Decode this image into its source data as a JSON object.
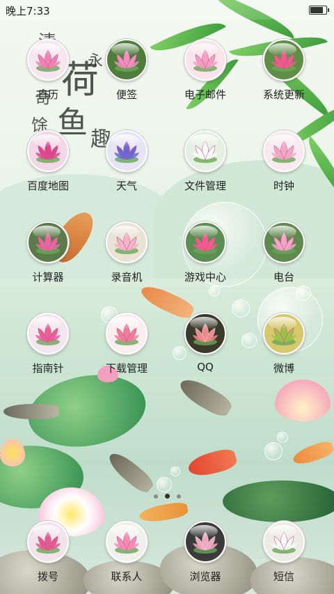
{
  "status_bar": {
    "time": "晚上7:33",
    "battery_level": 0.9
  },
  "icons": {
    "lotus": "lotus-flower-icon"
  },
  "apps": [
    {
      "id": "calendar",
      "label": "日历",
      "bg": "#f6e6ef",
      "flower": "#f07fb3"
    },
    {
      "id": "notes",
      "label": "便签",
      "bg": "#4f7d3c",
      "flower": "#f28dc0"
    },
    {
      "id": "email",
      "label": "电子邮件",
      "bg": "#fbe3ec",
      "flower": "#f59dc5"
    },
    {
      "id": "update",
      "label": "系统更新",
      "bg": "#5f8e46",
      "flower": "#ee5a8e"
    },
    {
      "id": "map",
      "label": "百度地图",
      "bg": "#f4d7e6",
      "flower": "#e0468a"
    },
    {
      "id": "weather",
      "label": "天气",
      "bg": "#e7e5f5",
      "flower": "#6b68d6"
    },
    {
      "id": "files",
      "label": "文件管理",
      "bg": "#e6f0e2",
      "flower": "#ffffff"
    },
    {
      "id": "clock",
      "label": "时钟",
      "bg": "#f7e9ee",
      "flower": "#f0a8c3"
    },
    {
      "id": "calc",
      "label": "计算器",
      "bg": "#5b7c4a",
      "flower": "#e668a2"
    },
    {
      "id": "recorder",
      "label": "录音机",
      "bg": "#e9e3d6",
      "flower": "#f2b4c9"
    },
    {
      "id": "games",
      "label": "游戏中心",
      "bg": "#5b8e52",
      "flower": "#f25b90"
    },
    {
      "id": "radio",
      "label": "电台",
      "bg": "#5f8a4d",
      "flower": "#f4a3c9"
    },
    {
      "id": "compass",
      "label": "指南针",
      "bg": "#f3e6ee",
      "flower": "#e85e97"
    },
    {
      "id": "downloads",
      "label": "下载管理",
      "bg": "#f8eef0",
      "flower": "#f07c9b"
    },
    {
      "id": "qq",
      "label": "QQ",
      "bg": "#3a3a2a",
      "flower": "#f08a8a"
    },
    {
      "id": "weibo",
      "label": "微博",
      "bg": "#d7c86d",
      "flower": "#9cc24a"
    }
  ],
  "dock": [
    {
      "id": "dialer",
      "label": "拨号",
      "bg": "#f2e3ea",
      "flower": "#e35a91"
    },
    {
      "id": "contacts",
      "label": "联系人",
      "bg": "#f0f0ee",
      "flower": "#f48ab5"
    },
    {
      "id": "browser",
      "label": "浏览器",
      "bg": "#3b3b3b",
      "flower": "#f2a6c0"
    },
    {
      "id": "sms",
      "label": "短信",
      "bg": "#ecebe6",
      "flower": "#fbfbf8"
    }
  ],
  "page_indicator": {
    "count": 3,
    "active": 1
  },
  "wallpaper": {
    "calligraphy": [
      "清",
      "荷",
      "鱼",
      "趣",
      "永",
      "奇",
      "馀"
    ]
  }
}
